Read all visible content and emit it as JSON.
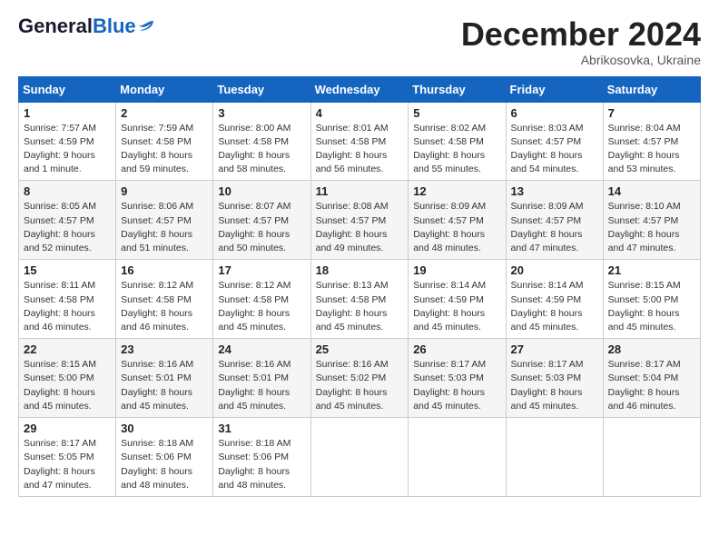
{
  "header": {
    "logo_general": "General",
    "logo_blue": "Blue",
    "month_title": "December 2024",
    "subtitle": "Abrikosovka, Ukraine"
  },
  "weekdays": [
    "Sunday",
    "Monday",
    "Tuesday",
    "Wednesday",
    "Thursday",
    "Friday",
    "Saturday"
  ],
  "weeks": [
    [
      {
        "day": "1",
        "sunrise": "7:57 AM",
        "sunset": "4:59 PM",
        "daylight": "9 hours and 1 minute."
      },
      {
        "day": "2",
        "sunrise": "7:59 AM",
        "sunset": "4:58 PM",
        "daylight": "8 hours and 59 minutes."
      },
      {
        "day": "3",
        "sunrise": "8:00 AM",
        "sunset": "4:58 PM",
        "daylight": "8 hours and 58 minutes."
      },
      {
        "day": "4",
        "sunrise": "8:01 AM",
        "sunset": "4:58 PM",
        "daylight": "8 hours and 56 minutes."
      },
      {
        "day": "5",
        "sunrise": "8:02 AM",
        "sunset": "4:58 PM",
        "daylight": "8 hours and 55 minutes."
      },
      {
        "day": "6",
        "sunrise": "8:03 AM",
        "sunset": "4:57 PM",
        "daylight": "8 hours and 54 minutes."
      },
      {
        "day": "7",
        "sunrise": "8:04 AM",
        "sunset": "4:57 PM",
        "daylight": "8 hours and 53 minutes."
      }
    ],
    [
      {
        "day": "8",
        "sunrise": "8:05 AM",
        "sunset": "4:57 PM",
        "daylight": "8 hours and 52 minutes."
      },
      {
        "day": "9",
        "sunrise": "8:06 AM",
        "sunset": "4:57 PM",
        "daylight": "8 hours and 51 minutes."
      },
      {
        "day": "10",
        "sunrise": "8:07 AM",
        "sunset": "4:57 PM",
        "daylight": "8 hours and 50 minutes."
      },
      {
        "day": "11",
        "sunrise": "8:08 AM",
        "sunset": "4:57 PM",
        "daylight": "8 hours and 49 minutes."
      },
      {
        "day": "12",
        "sunrise": "8:09 AM",
        "sunset": "4:57 PM",
        "daylight": "8 hours and 48 minutes."
      },
      {
        "day": "13",
        "sunrise": "8:09 AM",
        "sunset": "4:57 PM",
        "daylight": "8 hours and 47 minutes."
      },
      {
        "day": "14",
        "sunrise": "8:10 AM",
        "sunset": "4:57 PM",
        "daylight": "8 hours and 47 minutes."
      }
    ],
    [
      {
        "day": "15",
        "sunrise": "8:11 AM",
        "sunset": "4:58 PM",
        "daylight": "8 hours and 46 minutes."
      },
      {
        "day": "16",
        "sunrise": "8:12 AM",
        "sunset": "4:58 PM",
        "daylight": "8 hours and 46 minutes."
      },
      {
        "day": "17",
        "sunrise": "8:12 AM",
        "sunset": "4:58 PM",
        "daylight": "8 hours and 45 minutes."
      },
      {
        "day": "18",
        "sunrise": "8:13 AM",
        "sunset": "4:58 PM",
        "daylight": "8 hours and 45 minutes."
      },
      {
        "day": "19",
        "sunrise": "8:14 AM",
        "sunset": "4:59 PM",
        "daylight": "8 hours and 45 minutes."
      },
      {
        "day": "20",
        "sunrise": "8:14 AM",
        "sunset": "4:59 PM",
        "daylight": "8 hours and 45 minutes."
      },
      {
        "day": "21",
        "sunrise": "8:15 AM",
        "sunset": "5:00 PM",
        "daylight": "8 hours and 45 minutes."
      }
    ],
    [
      {
        "day": "22",
        "sunrise": "8:15 AM",
        "sunset": "5:00 PM",
        "daylight": "8 hours and 45 minutes."
      },
      {
        "day": "23",
        "sunrise": "8:16 AM",
        "sunset": "5:01 PM",
        "daylight": "8 hours and 45 minutes."
      },
      {
        "day": "24",
        "sunrise": "8:16 AM",
        "sunset": "5:01 PM",
        "daylight": "8 hours and 45 minutes."
      },
      {
        "day": "25",
        "sunrise": "8:16 AM",
        "sunset": "5:02 PM",
        "daylight": "8 hours and 45 minutes."
      },
      {
        "day": "26",
        "sunrise": "8:17 AM",
        "sunset": "5:03 PM",
        "daylight": "8 hours and 45 minutes."
      },
      {
        "day": "27",
        "sunrise": "8:17 AM",
        "sunset": "5:03 PM",
        "daylight": "8 hours and 45 minutes."
      },
      {
        "day": "28",
        "sunrise": "8:17 AM",
        "sunset": "5:04 PM",
        "daylight": "8 hours and 46 minutes."
      }
    ],
    [
      {
        "day": "29",
        "sunrise": "8:17 AM",
        "sunset": "5:05 PM",
        "daylight": "8 hours and 47 minutes."
      },
      {
        "day": "30",
        "sunrise": "8:18 AM",
        "sunset": "5:06 PM",
        "daylight": "8 hours and 48 minutes."
      },
      {
        "day": "31",
        "sunrise": "8:18 AM",
        "sunset": "5:06 PM",
        "daylight": "8 hours and 48 minutes."
      },
      null,
      null,
      null,
      null
    ]
  ],
  "labels": {
    "sunrise": "Sunrise:",
    "sunset": "Sunset:",
    "daylight": "Daylight:"
  }
}
